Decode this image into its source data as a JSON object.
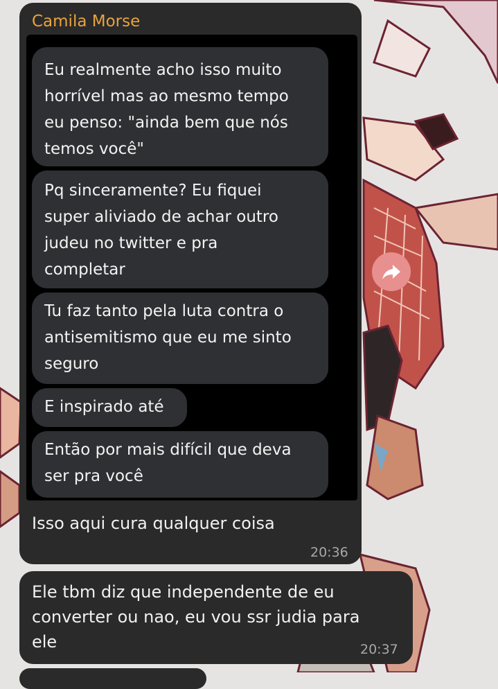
{
  "chat": {
    "sender_name": "Camila Morse",
    "colors": {
      "wallpaper": "#e6e4e2",
      "bubble": "#2a2a2b",
      "sender_name": "#e8a33c",
      "forward_button": "#e8908f"
    },
    "forwarded_screenshot": {
      "messages": [
        "Eu realmente acho isso muito\nhorrível mas ao mesmo tempo\neu penso: \"ainda bem que nós\ntemos você\"",
        "Pq sinceramente? Eu fiquei\nsuper aliviado de achar outro\njudeu no twitter e pra\ncompletar",
        "Tu faz tanto pela luta contra o\nantisemitismo que eu me sinto\nseguro",
        "E inspirado até",
        "Então por mais difícil que deva\nser pra você"
      ]
    },
    "messages": [
      {
        "text": "Isso aqui cura qualquer coisa",
        "time": "20:36"
      },
      {
        "text": "Ele tbm diz que independente de eu\nconverter ou nao, eu vou ssr judia para\nele",
        "time": "20:37"
      }
    ],
    "forward_icon": "share-arrow-icon"
  }
}
